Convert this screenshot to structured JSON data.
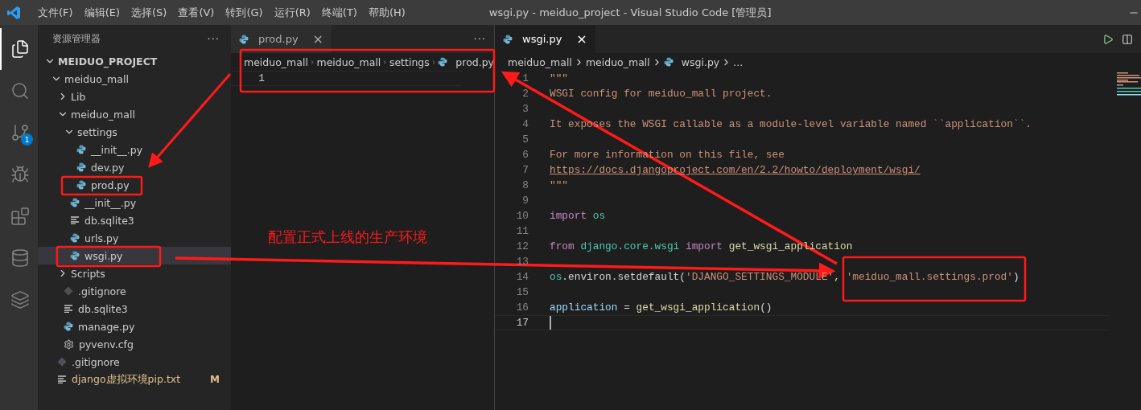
{
  "title_bar": {
    "menus": [
      "文件(F)",
      "编辑(E)",
      "选择(S)",
      "查看(V)",
      "转到(G)",
      "运行(R)",
      "终端(T)",
      "帮助(H)"
    ],
    "title": "wsgi.py - meiduo_project - Visual Studio Code [管理员]"
  },
  "activity_bar": [
    {
      "kind": "files",
      "selected": true
    },
    {
      "kind": "search",
      "selected": false
    },
    {
      "kind": "source-control",
      "selected": false,
      "badge": "1"
    },
    {
      "kind": "run",
      "selected": false
    },
    {
      "kind": "extensions",
      "selected": false
    },
    {
      "kind": "database",
      "selected": false
    },
    {
      "kind": "layers",
      "selected": false
    }
  ],
  "sidebar": {
    "title": "资源管理器",
    "more": "···",
    "tree": [
      {
        "label": "MEIDUO_PROJECT",
        "kind": "root",
        "expanded": true,
        "children": [
          {
            "label": "meiduo_mall",
            "kind": "folder",
            "expanded": true,
            "children": [
              {
                "label": "Lib",
                "kind": "folder",
                "expanded": false
              },
              {
                "label": "meiduo_mall",
                "kind": "folder",
                "expanded": true,
                "children": [
                  {
                    "label": "settings",
                    "kind": "folder",
                    "expanded": true,
                    "children": [
                      {
                        "label": "__init__.py",
                        "kind": "python",
                        "selected": false
                      },
                      {
                        "label": "dev.py",
                        "kind": "python",
                        "selected": false
                      },
                      {
                        "label": "prod.py",
                        "kind": "python",
                        "selected": false
                      }
                    ]
                  },
                  {
                    "label": "__init__.py",
                    "kind": "python",
                    "selected": false
                  },
                  {
                    "label": "db.sqlite3",
                    "kind": "text",
                    "selected": false
                  },
                  {
                    "label": "urls.py",
                    "kind": "python",
                    "selected": false
                  },
                  {
                    "label": "wsgi.py",
                    "kind": "python",
                    "selected": true
                  }
                ]
              },
              {
                "label": "Scripts",
                "kind": "folder",
                "expanded": false
              },
              {
                "label": ".gitignore",
                "kind": "git",
                "selected": false
              },
              {
                "label": "db.sqlite3",
                "kind": "text",
                "selected": false
              },
              {
                "label": "manage.py",
                "kind": "python",
                "selected": false
              },
              {
                "label": "pyvenv.cfg",
                "kind": "gear",
                "selected": false
              }
            ]
          },
          {
            "label": ".gitignore",
            "kind": "git",
            "selected": false
          },
          {
            "label": "django虚拟环境pip.txt",
            "kind": "text",
            "selected": false,
            "modified": true,
            "badge": "M"
          }
        ]
      }
    ]
  },
  "editors": [
    {
      "tab": {
        "label": "prod.py",
        "close": "×"
      },
      "more": "···",
      "breadcrumbs": [
        "meiduo_mall",
        "meiduo_mall",
        "settings",
        "prod.py"
      ],
      "lines": [
        {
          "number": "1",
          "current": true
        }
      ]
    },
    {
      "tab": {
        "label": "wsgi.py",
        "close": "×"
      },
      "breadcrumbs": [
        "meiduo_mall",
        "meiduo_mall",
        "wsgi.py",
        "..."
      ],
      "lines": [
        {
          "number": "1",
          "current": false,
          "tokens": [
            {
              "kind": "string",
              "text": "\"\"\""
            }
          ]
        },
        {
          "number": "2",
          "current": false,
          "tokens": [
            {
              "kind": "string",
              "text": "WSGI config for meiduo_mall project."
            }
          ]
        },
        {
          "number": "3",
          "current": false
        },
        {
          "number": "4",
          "current": false,
          "tokens": [
            {
              "kind": "string",
              "text": "It exposes the WSGI callable as a module-level variable named ``application``."
            }
          ]
        },
        {
          "number": "5",
          "current": false
        },
        {
          "number": "6",
          "current": false,
          "tokens": [
            {
              "kind": "string",
              "text": "For more information on this file, see"
            }
          ]
        },
        {
          "number": "7",
          "current": false,
          "tokens": [
            {
              "kind": "link",
              "text": "https://docs.djangoproject.com/en/2.2/howto/deployment/wsgi/"
            }
          ]
        },
        {
          "number": "8",
          "current": false,
          "tokens": [
            {
              "kind": "string",
              "text": "\"\"\""
            }
          ]
        },
        {
          "number": "9",
          "current": false
        },
        {
          "number": "10",
          "current": false,
          "tokens": [
            {
              "kind": "keyword",
              "text": "import"
            },
            {
              "kind": "module",
              "text": " os"
            }
          ]
        },
        {
          "number": "11",
          "current": false
        },
        {
          "number": "12",
          "current": false,
          "tokens": [
            {
              "kind": "keyword",
              "text": "from"
            },
            {
              "kind": "module",
              "text": " django.core.wsgi"
            },
            {
              "kind": "keyword",
              "text": " import"
            },
            {
              "kind": "function",
              "text": " get_wsgi_application"
            }
          ]
        },
        {
          "number": "13",
          "current": false
        },
        {
          "number": "14",
          "current": false,
          "tokens": [
            {
              "kind": "module",
              "text": "os"
            },
            {
              "kind": "plain",
              "text": ".environ.setdefault("
            },
            {
              "kind": "string",
              "text": "'DJANGO_SETTINGS_MODULE'"
            },
            {
              "kind": "plain",
              "text": ", "
            },
            {
              "kind": "string",
              "text": "'meiduo_mall.settings.prod'"
            },
            {
              "kind": "plain",
              "text": ")"
            }
          ]
        },
        {
          "number": "15",
          "current": false
        },
        {
          "number": "16",
          "current": false,
          "tokens": [
            {
              "kind": "variable",
              "text": "application"
            },
            {
              "kind": "plain",
              "text": " = "
            },
            {
              "kind": "function",
              "text": "get_wsgi_application"
            },
            {
              "kind": "plain",
              "text": "()"
            }
          ]
        },
        {
          "number": "17",
          "current": true
        }
      ]
    }
  ],
  "annotation": {
    "note": "配置正式上线的生产环境"
  }
}
